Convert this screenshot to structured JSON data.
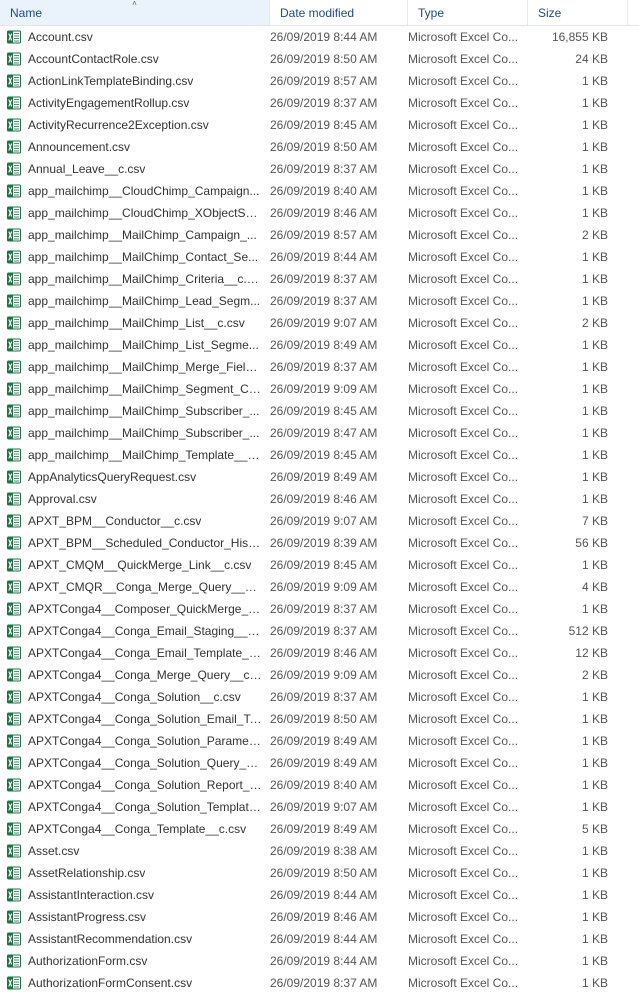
{
  "columns": {
    "name": "Name",
    "date": "Date modified",
    "type": "Type",
    "size": "Size"
  },
  "sort": {
    "column": "name",
    "direction": "asc"
  },
  "type_label": "Microsoft Excel Co...",
  "files": [
    {
      "name": "Account.csv",
      "date": "26/09/2019 8:44 AM",
      "size": "16,855 KB"
    },
    {
      "name": "AccountContactRole.csv",
      "date": "26/09/2019 8:50 AM",
      "size": "24 KB"
    },
    {
      "name": "ActionLinkTemplateBinding.csv",
      "date": "26/09/2019 8:57 AM",
      "size": "1 KB"
    },
    {
      "name": "ActivityEngagementRollup.csv",
      "date": "26/09/2019 8:37 AM",
      "size": "1 KB"
    },
    {
      "name": "ActivityRecurrence2Exception.csv",
      "date": "26/09/2019 8:45 AM",
      "size": "1 KB"
    },
    {
      "name": "Announcement.csv",
      "date": "26/09/2019 8:50 AM",
      "size": "1 KB"
    },
    {
      "name": "Annual_Leave__c.csv",
      "date": "26/09/2019 8:37 AM",
      "size": "1 KB"
    },
    {
      "name": "app_mailchimp__CloudChimp_Campaign...",
      "date": "26/09/2019 8:40 AM",
      "size": "1 KB"
    },
    {
      "name": "app_mailchimp__CloudChimp_XObjectSe...",
      "date": "26/09/2019 8:46 AM",
      "size": "1 KB"
    },
    {
      "name": "app_mailchimp__MailChimp_Campaign_...",
      "date": "26/09/2019 8:57 AM",
      "size": "2 KB"
    },
    {
      "name": "app_mailchimp__MailChimp_Contact_Se...",
      "date": "26/09/2019 8:44 AM",
      "size": "1 KB"
    },
    {
      "name": "app_mailchimp__MailChimp_Criteria__c.csv",
      "date": "26/09/2019 8:37 AM",
      "size": "1 KB"
    },
    {
      "name": "app_mailchimp__MailChimp_Lead_Segm...",
      "date": "26/09/2019 8:37 AM",
      "size": "1 KB"
    },
    {
      "name": "app_mailchimp__MailChimp_List__c.csv",
      "date": "26/09/2019 9:07 AM",
      "size": "2 KB"
    },
    {
      "name": "app_mailchimp__MailChimp_List_Segme...",
      "date": "26/09/2019 8:49 AM",
      "size": "1 KB"
    },
    {
      "name": "app_mailchimp__MailChimp_Merge_Field...",
      "date": "26/09/2019 8:37 AM",
      "size": "1 KB"
    },
    {
      "name": "app_mailchimp__MailChimp_Segment_Cr...",
      "date": "26/09/2019 9:09 AM",
      "size": "1 KB"
    },
    {
      "name": "app_mailchimp__MailChimp_Subscriber_...",
      "date": "26/09/2019 8:45 AM",
      "size": "1 KB"
    },
    {
      "name": "app_mailchimp__MailChimp_Subscriber_...",
      "date": "26/09/2019 8:47 AM",
      "size": "1 KB"
    },
    {
      "name": "app_mailchimp__MailChimp_Template__c...",
      "date": "26/09/2019 8:45 AM",
      "size": "1 KB"
    },
    {
      "name": "AppAnalyticsQueryRequest.csv",
      "date": "26/09/2019 8:49 AM",
      "size": "1 KB"
    },
    {
      "name": "Approval.csv",
      "date": "26/09/2019 8:46 AM",
      "size": "1 KB"
    },
    {
      "name": "APXT_BPM__Conductor__c.csv",
      "date": "26/09/2019 9:07 AM",
      "size": "7 KB"
    },
    {
      "name": "APXT_BPM__Scheduled_Conductor_Histor...",
      "date": "26/09/2019 8:39 AM",
      "size": "56 KB"
    },
    {
      "name": "APXT_CMQM__QuickMerge_Link__c.csv",
      "date": "26/09/2019 8:45 AM",
      "size": "1 KB"
    },
    {
      "name": "APXT_CMQR__Conga_Merge_Query__c.csv",
      "date": "26/09/2019 9:09 AM",
      "size": "4 KB"
    },
    {
      "name": "APXTConga4__Composer_QuickMerge__c....",
      "date": "26/09/2019 8:37 AM",
      "size": "1 KB"
    },
    {
      "name": "APXTConga4__Conga_Email_Staging__c.csv",
      "date": "26/09/2019 8:37 AM",
      "size": "512 KB"
    },
    {
      "name": "APXTConga4__Conga_Email_Template__c...",
      "date": "26/09/2019 8:46 AM",
      "size": "12 KB"
    },
    {
      "name": "APXTConga4__Conga_Merge_Query__c.csv",
      "date": "26/09/2019 9:09 AM",
      "size": "2 KB"
    },
    {
      "name": "APXTConga4__Conga_Solution__c.csv",
      "date": "26/09/2019 8:37 AM",
      "size": "1 KB"
    },
    {
      "name": "APXTConga4__Conga_Solution_Email_Te...",
      "date": "26/09/2019 8:50 AM",
      "size": "1 KB"
    },
    {
      "name": "APXTConga4__Conga_Solution_Paramete...",
      "date": "26/09/2019 8:49 AM",
      "size": "1 KB"
    },
    {
      "name": "APXTConga4__Conga_Solution_Query__c....",
      "date": "26/09/2019 8:49 AM",
      "size": "1 KB"
    },
    {
      "name": "APXTConga4__Conga_Solution_Report__c...",
      "date": "26/09/2019 8:40 AM",
      "size": "1 KB"
    },
    {
      "name": "APXTConga4__Conga_Solution_Template...",
      "date": "26/09/2019 9:07 AM",
      "size": "1 KB"
    },
    {
      "name": "APXTConga4__Conga_Template__c.csv",
      "date": "26/09/2019 8:49 AM",
      "size": "5 KB"
    },
    {
      "name": "Asset.csv",
      "date": "26/09/2019 8:38 AM",
      "size": "1 KB"
    },
    {
      "name": "AssetRelationship.csv",
      "date": "26/09/2019 8:50 AM",
      "size": "1 KB"
    },
    {
      "name": "AssistantInteraction.csv",
      "date": "26/09/2019 8:44 AM",
      "size": "1 KB"
    },
    {
      "name": "AssistantProgress.csv",
      "date": "26/09/2019 8:46 AM",
      "size": "1 KB"
    },
    {
      "name": "AssistantRecommendation.csv",
      "date": "26/09/2019 8:44 AM",
      "size": "1 KB"
    },
    {
      "name": "AuthorizationForm.csv",
      "date": "26/09/2019 8:44 AM",
      "size": "1 KB"
    },
    {
      "name": "AuthorizationFormConsent.csv",
      "date": "26/09/2019 8:37 AM",
      "size": "1 KB"
    }
  ]
}
